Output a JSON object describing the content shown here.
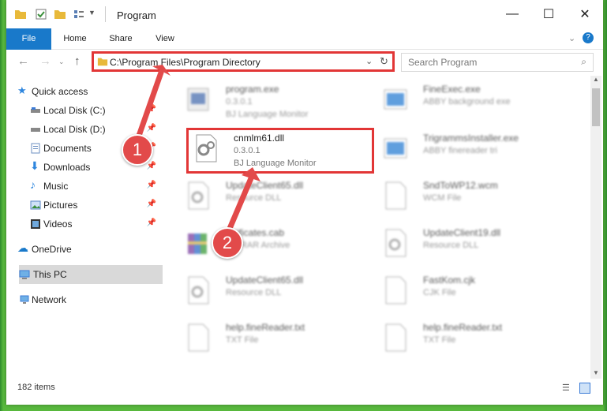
{
  "window": {
    "title": "Program"
  },
  "ribbon": {
    "tabs": [
      "File",
      "Home",
      "Share",
      "View"
    ]
  },
  "address": {
    "path": "C:\\Program Files\\Program Directory"
  },
  "search": {
    "placeholder": "Search Program"
  },
  "sidebar": {
    "items": [
      {
        "label": "Quick access"
      },
      {
        "label": "Local Disk (C:)"
      },
      {
        "label": "Local Disk (D:)"
      },
      {
        "label": "Documents"
      },
      {
        "label": "Downloads"
      },
      {
        "label": "Music"
      },
      {
        "label": "Pictures"
      },
      {
        "label": "Videos"
      },
      {
        "label": "OneDrive"
      },
      {
        "label": "This PC"
      },
      {
        "label": "Network"
      }
    ]
  },
  "files": [
    {
      "name": "program.exe",
      "line1": "0.3.0.1",
      "line2": "BJ Language Monitor"
    },
    {
      "name": "FineExec.exe",
      "line1": "ABBY background exe",
      "line2": ""
    },
    {
      "name": "cnmlm61.dll",
      "line1": "0.3.0.1",
      "line2": "BJ Language Monitor"
    },
    {
      "name": "TrigrammsInstaller.exe",
      "line1": "ABBY finereader tri",
      "line2": ""
    },
    {
      "name": "UpdateClient65.dll",
      "line1": "Resource DLL",
      "line2": ""
    },
    {
      "name": "SndToWP12.wcm",
      "line1": "WCM File",
      "line2": ""
    },
    {
      "name": "ertificates.cab",
      "line1": "WinRAR Archive",
      "line2": ""
    },
    {
      "name": "UpdateClient19.dll",
      "line1": "Resource DLL",
      "line2": ""
    },
    {
      "name": "UpdateClient65.dll",
      "line1": "Resource DLL",
      "line2": ""
    },
    {
      "name": "FastKom.cjk",
      "line1": "CJK File",
      "line2": ""
    },
    {
      "name": "help.fineReader.txt",
      "line1": "TXT File",
      "line2": ""
    },
    {
      "name": "help.fineReader.txt",
      "line1": "TXT File",
      "line2": ""
    }
  ],
  "status": {
    "count": "182 items"
  },
  "markers": [
    "1",
    "2"
  ],
  "colors": {
    "accent": "#1979ca",
    "highlight": "#e23636",
    "marker": "#e24a4a"
  }
}
